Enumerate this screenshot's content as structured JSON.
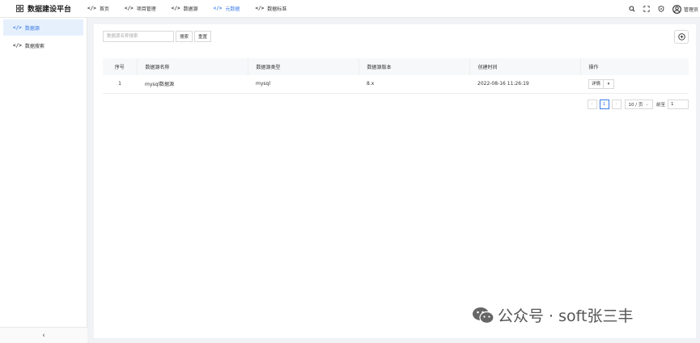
{
  "app": {
    "title": "数据建设平台"
  },
  "nav": {
    "items": [
      {
        "label": "首页"
      },
      {
        "label": "项目管理"
      },
      {
        "label": "数据源"
      },
      {
        "label": "元数据"
      },
      {
        "label": "数据标准"
      }
    ]
  },
  "user": {
    "name": "管理员"
  },
  "sidebar": {
    "items": [
      {
        "label": "数据源"
      },
      {
        "label": "数据搜索"
      }
    ],
    "collapse_label": "‹"
  },
  "search": {
    "placeholder": "数据源名称搜索",
    "search_label": "搜索",
    "reset_label": "重置"
  },
  "table": {
    "columns": [
      "序号",
      "数据源名称",
      "数据源类型",
      "数据源版本",
      "创建时间",
      "操作"
    ],
    "rows": [
      {
        "index": "1",
        "name": "mysql数据源",
        "type": "mysql",
        "version": "8.x",
        "created": "2022-08-16 11:26:19",
        "action": "详情"
      }
    ]
  },
  "pagination": {
    "prev": "‹",
    "current_page": "1",
    "next": "›",
    "page_size": "10 / 页",
    "jump_label": "前至",
    "jump_value": "1"
  },
  "watermark": {
    "text": "公众号 · soft张三丰"
  },
  "colors": {
    "accent": "#3b7be8",
    "background": "#f0f2f5"
  }
}
